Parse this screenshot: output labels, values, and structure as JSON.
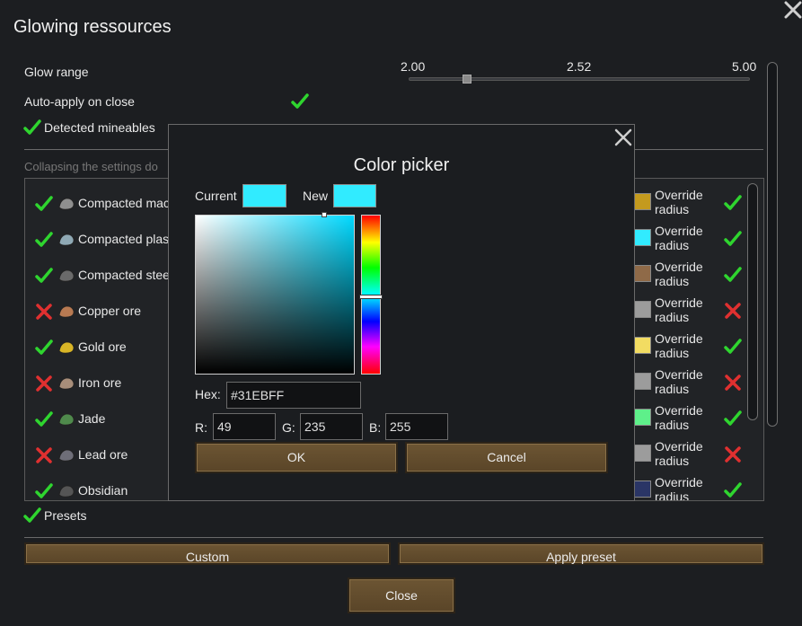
{
  "window": {
    "title": "Glowing ressources",
    "glow_range_label": "Glow range",
    "slider": {
      "min_label": "2.00",
      "value_label": "2.52",
      "max_label": "5.00",
      "value": 2.52,
      "min": 2.0,
      "max": 5.0
    },
    "auto_apply_label": "Auto-apply on close",
    "detected_mineables_label": "Detected mineables",
    "collapse_hint": "Collapsing the settings do",
    "presets_label": "Presets",
    "custom_button": "Custom",
    "apply_preset_button": "Apply preset",
    "close_button": "Close"
  },
  "minerals": [
    {
      "name": "Compacted mac",
      "enabled": true,
      "swatch": "#c49a1e",
      "override_label": "Override radius",
      "override": true,
      "icon": "compacted-machinery-icon",
      "icon_color": "#8f8f8f"
    },
    {
      "name": "Compacted plas",
      "enabled": true,
      "swatch": "#31ebff",
      "override_label": "Override radius",
      "override": true,
      "icon": "compacted-plasteel-icon",
      "icon_color": "#8fa9b5"
    },
    {
      "name": "Compacted stee",
      "enabled": true,
      "swatch": "#8f6a48",
      "override_label": "Override radius",
      "override": true,
      "icon": "compacted-steel-icon",
      "icon_color": "#6a6a6a"
    },
    {
      "name": "Copper ore",
      "enabled": false,
      "swatch": "#9c9c9c",
      "override_label": "Override radius",
      "override": false,
      "icon": "copper-ore-icon",
      "icon_color": "#b87a52"
    },
    {
      "name": "Gold ore",
      "enabled": true,
      "swatch": "#f2dc62",
      "override_label": "Override radius",
      "override": true,
      "icon": "gold-ore-icon",
      "icon_color": "#d9b526"
    },
    {
      "name": "Iron ore",
      "enabled": false,
      "swatch": "#9c9c9c",
      "override_label": "Override radius",
      "override": false,
      "icon": "iron-ore-icon",
      "icon_color": "#a88e7a"
    },
    {
      "name": "Jade",
      "enabled": true,
      "swatch": "#5ef08a",
      "override_label": "Override radius",
      "override": true,
      "icon": "jade-icon",
      "icon_color": "#4f8a4c"
    },
    {
      "name": "Lead ore",
      "enabled": false,
      "swatch": "#9c9c9c",
      "override_label": "Override radius",
      "override": false,
      "icon": "lead-ore-icon",
      "icon_color": "#6e6e78"
    },
    {
      "name": "Obsidian",
      "enabled": true,
      "swatch": "#2a3566",
      "override_label": "Override radius",
      "override": true,
      "icon": "obsidian-icon",
      "icon_color": "#555"
    }
  ],
  "color_picker": {
    "title": "Color picker",
    "current_label": "Current",
    "current_color": "#31ebff",
    "new_label": "New",
    "new_color": "#31ebff",
    "hex_label": "Hex:",
    "hex_value": "#31EBFF",
    "r_label": "R:",
    "r_value": "49",
    "g_label": "G:",
    "g_value": "235",
    "b_label": "B:",
    "b_value": "255",
    "ok_button": "OK",
    "cancel_button": "Cancel"
  },
  "colors": {
    "check": "#2fd52f",
    "cross": "#e03030",
    "button": "#5f4a2b",
    "background": "#1c1e21"
  }
}
